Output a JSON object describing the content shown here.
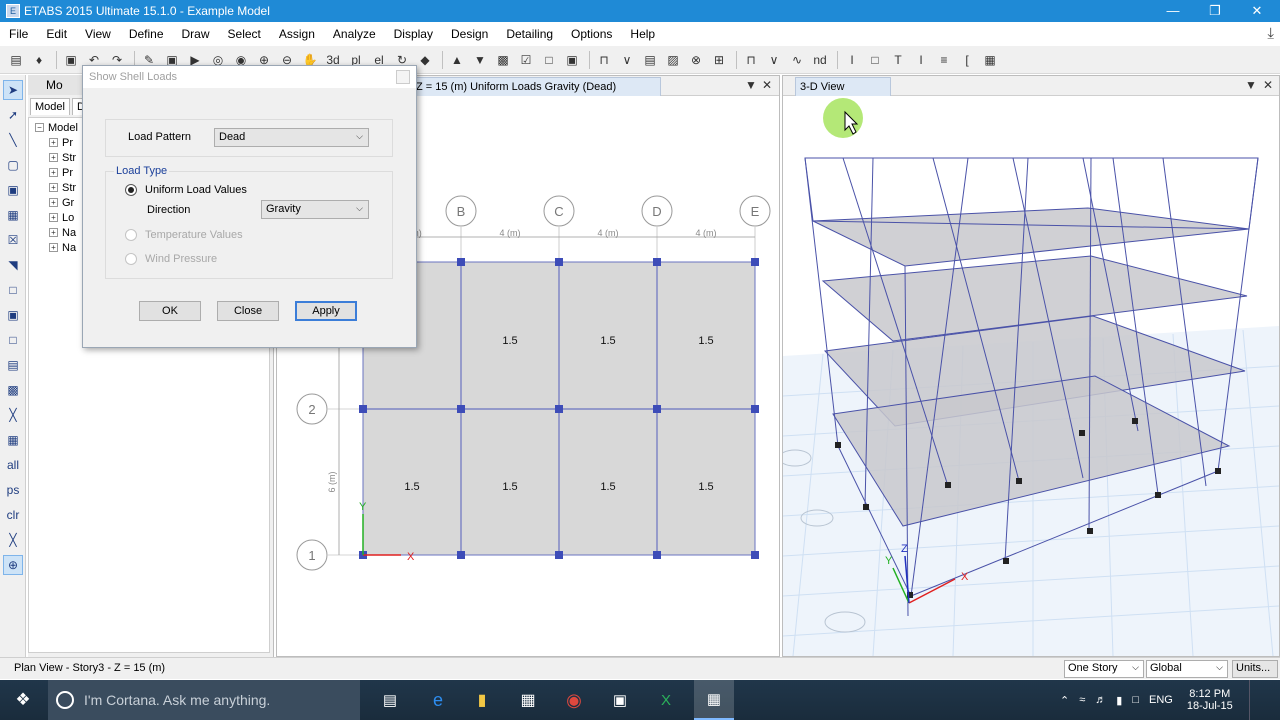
{
  "window": {
    "title": "ETABS 2015 Ultimate 15.1.0 - Example Model"
  },
  "menu": [
    "File",
    "Edit",
    "View",
    "Define",
    "Draw",
    "Select",
    "Assign",
    "Analyze",
    "Display",
    "Design",
    "Detailing",
    "Options",
    "Help"
  ],
  "explorer": {
    "header": "Mo",
    "tabs": [
      "Model",
      "Di"
    ],
    "root": "Model",
    "nodes": [
      "Pr",
      "Str",
      "Pr",
      "Str",
      "Gr",
      "Lo",
      "Na",
      "Na"
    ]
  },
  "plan_view": {
    "tab_title": "Z = 15 (m)  Uniform Loads Gravity  (Dead)",
    "grid_cols": [
      "B",
      "C",
      "D",
      "E"
    ],
    "grid_rows": [
      "2",
      "1"
    ],
    "spacings": [
      "4 (m)",
      "4 (m)",
      "4 (m)"
    ],
    "partial_spacing": "(m)",
    "row_spacing": "6 (m)",
    "loads": [
      "1.5",
      "1.5",
      "1.5",
      "1.5",
      "1.5",
      "1.5",
      "1.5",
      "1.5"
    ],
    "axis_x": "X",
    "axis_y": "Y"
  },
  "view3d": {
    "tab_title": "3-D View",
    "axis_x": "X",
    "axis_y": "Y",
    "axis_z": "Z"
  },
  "dialog": {
    "title": "Show Shell Loads",
    "load_pattern_label": "Load Pattern",
    "load_pattern_value": "Dead",
    "load_type_label": "Load Type",
    "uniform_label": "Uniform  Load  Values",
    "direction_label": "Direction",
    "direction_value": "Gravity",
    "temperature_label": "Temperature Values",
    "wind_label": "Wind Pressure",
    "ok": "OK",
    "close": "Close",
    "apply": "Apply"
  },
  "status": {
    "text": "Plan View - Story3 - Z = 15 (m)",
    "story_combo": "One Story",
    "coord_combo": "Global",
    "units_btn": "Units..."
  },
  "taskbar": {
    "cortana_placeholder": "I'm Cortana. Ask me anything.",
    "lang": "ENG",
    "time": "8:12 PM",
    "date": "18-Jul-15"
  }
}
